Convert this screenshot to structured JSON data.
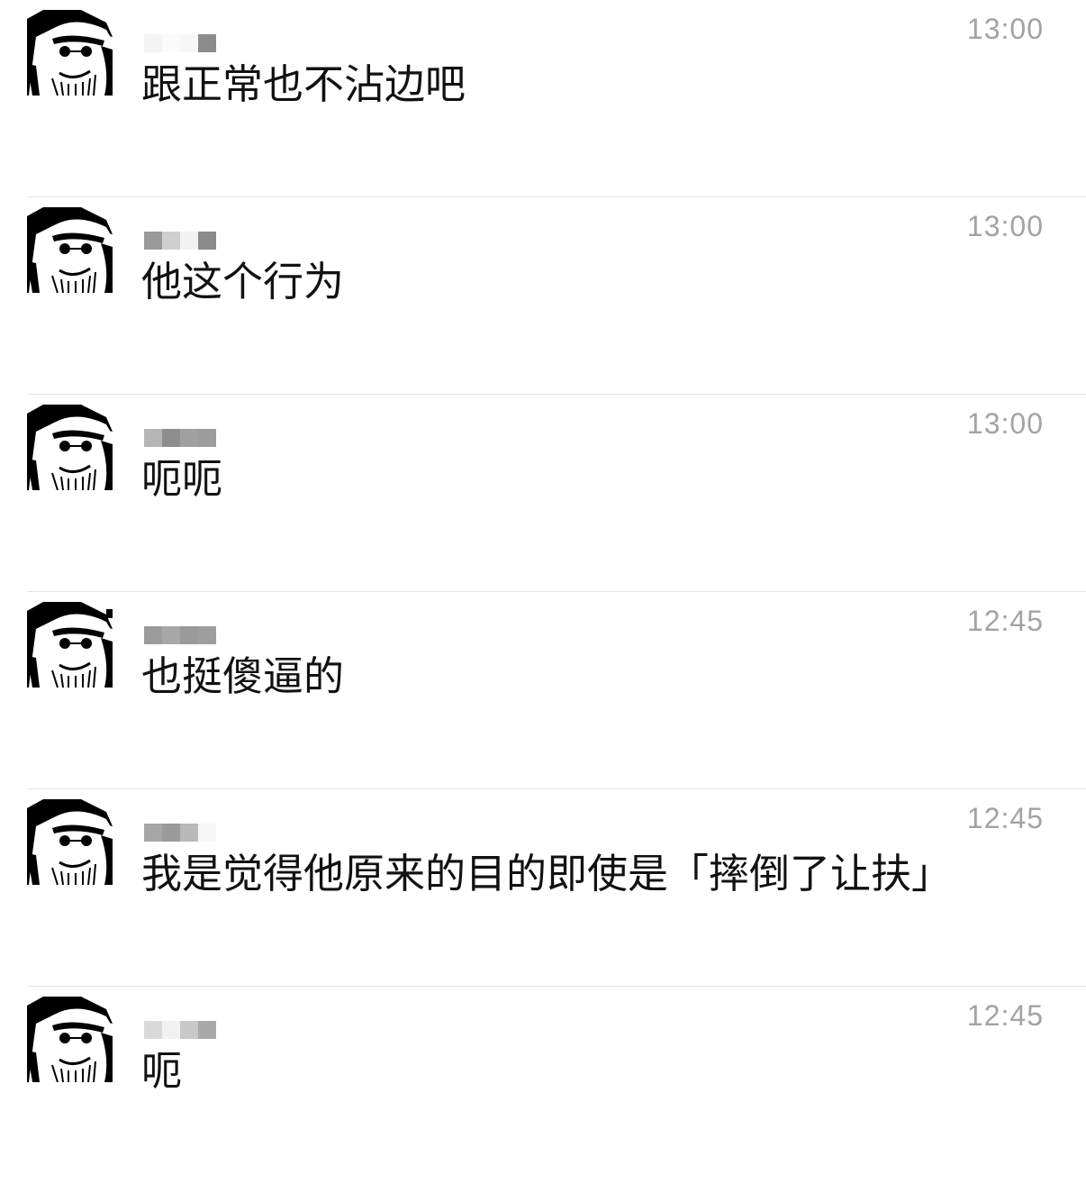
{
  "messages": [
    {
      "text": "跟正常也不沾边吧",
      "time": "13:00"
    },
    {
      "text": "他这个行为",
      "time": "13:00"
    },
    {
      "text": "呃呃",
      "time": "13:00"
    },
    {
      "text": "也挺傻逼的",
      "time": "12:45"
    },
    {
      "text": "我是觉得他原来的目的即使是「摔倒了让扶」",
      "time": "12:45"
    },
    {
      "text": "呃",
      "time": "12:45"
    }
  ],
  "colors": {
    "background": "#ffffff",
    "message_text": "#111111",
    "timestamp_text": "#a3a3a3",
    "divider": "#e3e3e3"
  },
  "icons": {
    "avatar": "bearded-man-avatar-icon"
  }
}
